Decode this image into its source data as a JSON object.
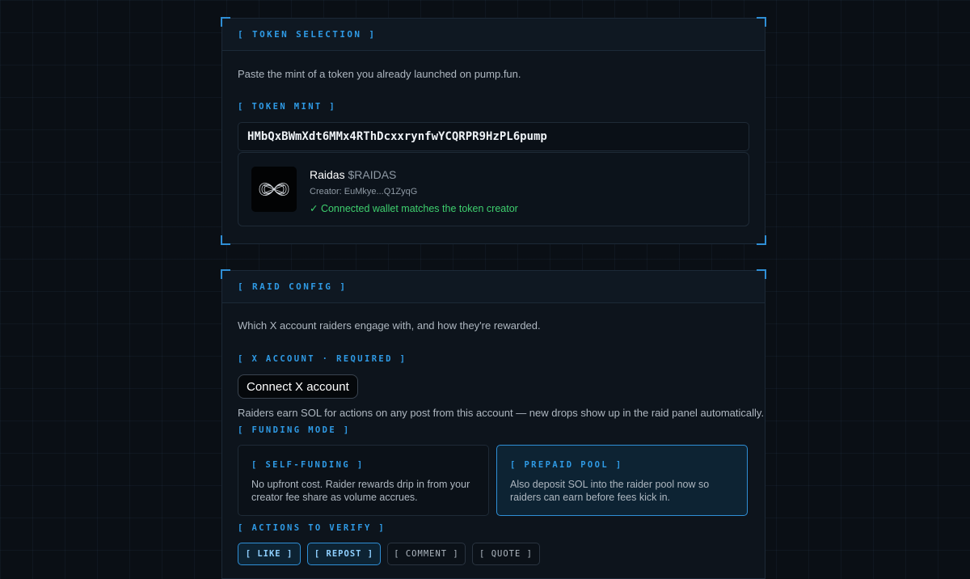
{
  "token_selection": {
    "header": "[ TOKEN SELECTION ]",
    "description": "Paste the mint of a token you already launched on pump.fun.",
    "mint_label": "[ TOKEN MINT ]",
    "mint_value": "HMbQxBWmXdt6MMx4RThDcxxrynfwYCQRPR9HzPL6pump",
    "token": {
      "name": "Raidas",
      "symbol": "$RAIDAS",
      "creator": "Creator: EuMkye...Q1ZyqG",
      "match_status": "✓ Connected wallet matches the token creator",
      "logo_icon": "infinity-knot-icon"
    }
  },
  "raid_config": {
    "header": "[ RAID CONFIG ]",
    "description": "Which X account raiders engage with, and how they're rewarded.",
    "x_account_label": "[ X ACCOUNT · REQUIRED ]",
    "connect_button": "Connect X account",
    "x_account_help": "Raiders earn SOL for actions on any post from this account — new drops show up in the raid panel automatically.",
    "funding_mode_label": "[ FUNDING MODE ]",
    "funding_modes": [
      {
        "title": "[ SELF-FUNDING ]",
        "description": "No upfront cost. Raider rewards drip in from your creator fee share as volume accrues.",
        "selected": false
      },
      {
        "title": "[ PREPAID POOL ]",
        "description": "Also deposit SOL into the raider pool now so raiders can earn before fees kick in.",
        "selected": true
      }
    ],
    "actions_label": "[ ACTIONS TO VERIFY ]",
    "actions": [
      {
        "label": "[ LIKE ]",
        "active": true
      },
      {
        "label": "[ REPOST ]",
        "active": true
      },
      {
        "label": "[ COMMENT ]",
        "active": false
      },
      {
        "label": "[ QUOTE ]",
        "active": false
      }
    ]
  },
  "colors": {
    "accent": "#2f9be6",
    "success": "#3ecf6e",
    "background": "#0a0f15"
  }
}
